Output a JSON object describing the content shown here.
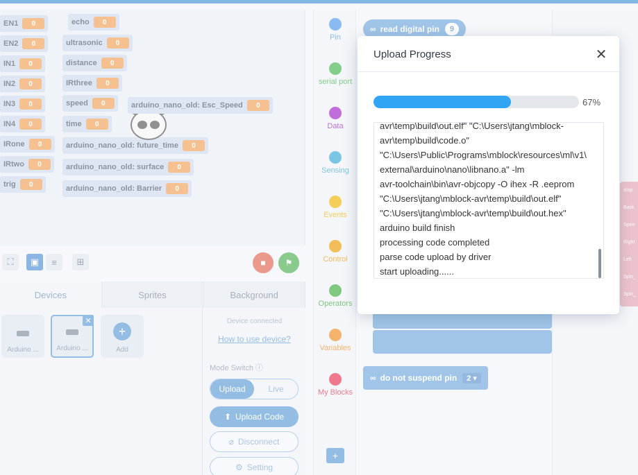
{
  "stage": {
    "variables": [
      {
        "label": "EN1",
        "value": "0"
      },
      {
        "label": "EN2",
        "value": "0"
      },
      {
        "label": "IN1",
        "value": "0"
      },
      {
        "label": "IN2",
        "value": "0"
      },
      {
        "label": "IN3",
        "value": "0"
      },
      {
        "label": "IN4",
        "value": "0"
      },
      {
        "label": "IRone",
        "value": "0"
      },
      {
        "label": "IRtwo",
        "value": "0"
      },
      {
        "label": "trig",
        "value": "0"
      },
      {
        "label": "echo",
        "value": "0"
      },
      {
        "label": "ultrasonic",
        "value": "0"
      },
      {
        "label": "distance",
        "value": "0"
      },
      {
        "label": "IRthree",
        "value": "0"
      },
      {
        "label": "speed",
        "value": "0"
      },
      {
        "label": "time",
        "value": "0"
      },
      {
        "label": "arduino_nano_old: future_time",
        "value": "0"
      },
      {
        "label": "arduino_nano_old: surface",
        "value": "0"
      },
      {
        "label": "arduino_nano_old: Barrier",
        "value": "0"
      },
      {
        "label": "arduino_nano_old: Esc_Speed",
        "value": "0"
      }
    ]
  },
  "device_panel": {
    "tabs": [
      "Devices",
      "Sprites",
      "Background"
    ],
    "devices": [
      {
        "label": "Arduino ..."
      },
      {
        "label": "Arduino ..."
      }
    ],
    "add_label": "Add",
    "connected_text": "Device connected",
    "howto_link": "How to use device?",
    "mode_switch_label": "Mode Switch ⓘ",
    "mode_upload": "Upload",
    "mode_live": "Live",
    "upload_code": "Upload Code",
    "disconnect": "Disconnect",
    "setting": "Setting"
  },
  "categories": [
    {
      "label": "Pin",
      "color": "#4c97e8"
    },
    {
      "label": "serial port",
      "color": "#3fb24a"
    },
    {
      "label": "Data",
      "color": "#a020c8"
    },
    {
      "label": "Sensing",
      "color": "#37a8d8"
    },
    {
      "label": "Events",
      "color": "#f0b400"
    },
    {
      "label": "Control",
      "color": "#f09a00"
    },
    {
      "label": "Operators",
      "color": "#3caa3c"
    },
    {
      "label": "Variables",
      "color": "#f08a20"
    },
    {
      "label": "My Blocks",
      "color": "#e8304f"
    }
  ],
  "palette": {
    "read_digital_pin": "read digital pin",
    "read_digital_pin_value": "9",
    "do_not_suspend_pin": "do not suspend pin",
    "do_not_suspend_pin_value": "2"
  },
  "side_blocks": [
    "stop",
    "Back",
    "Spee",
    "Right",
    "Left",
    "Spin_",
    "Spin_"
  ],
  "modal": {
    "title": "Upload Progress",
    "close_icon": "close-icon",
    "progress_percent": 67,
    "progress_label": "67%",
    "log_lines": [
      "avr\\temp\\build\\out.elf\" \"C:\\Users\\jtang\\mblock-",
      "avr\\temp\\build\\code.o\"",
      "\"C:\\Users\\Public\\Programs\\mblock\\resources\\ml\\v1\\",
      "external\\arduino\\nano\\libnano.a\" -lm",
      "avr-toolchain\\bin\\avr-objcopy -O ihex -R .eeprom",
      "\"C:\\Users\\jtang\\mblock-avr\\temp\\build\\out.elf\"",
      "\"C:\\Users\\jtang\\mblock-avr\\temp\\build\\out.hex\"",
      "arduino build finish",
      "processing code completed",
      "parse code upload by driver",
      "start uploading......"
    ]
  }
}
